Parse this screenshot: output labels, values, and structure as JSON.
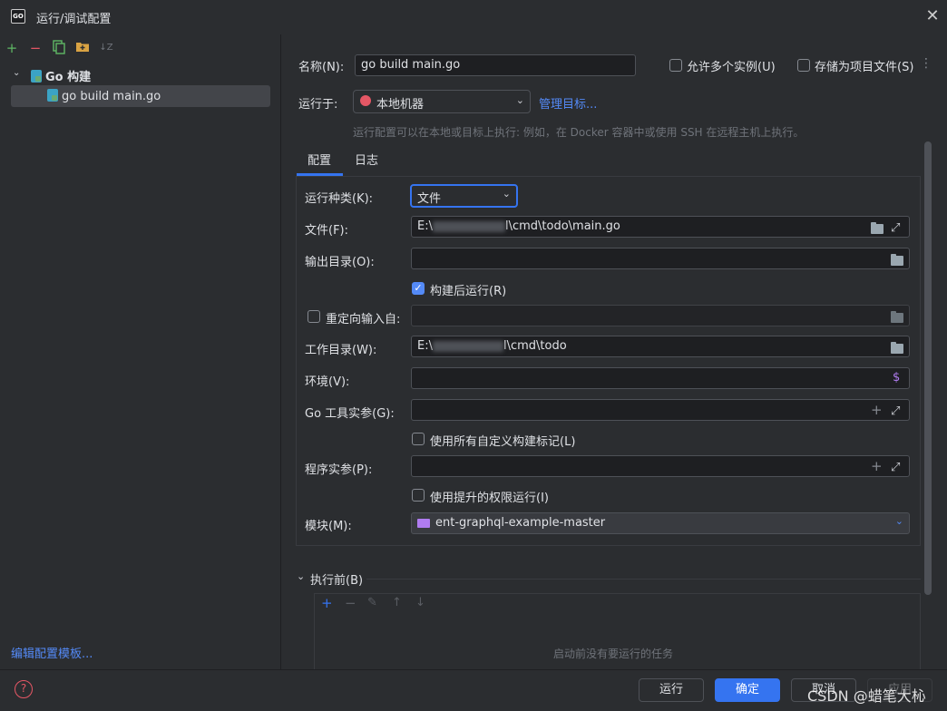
{
  "window": {
    "title": "运行/调试配置",
    "app_icon_text": "GO"
  },
  "left": {
    "toolbar": [
      "add-icon",
      "remove-icon",
      "copy-icon",
      "folder-icon",
      "sort-icon"
    ],
    "group_label": "Go 构建",
    "item_label": "go build main.go",
    "edit_templates": "编辑配置模板..."
  },
  "form": {
    "name_label": "名称(N):",
    "name_value": "go build main.go",
    "allow_multiple": "允许多个实例(U)",
    "store_as_file": "存储为项目文件(S)",
    "run_on_label": "运行于:",
    "run_on_value": "本地机器",
    "manage_targets": "管理目标...",
    "run_on_hint": "运行配置可以在本地或目标上执行: 例如，在 Docker 容器中或使用 SSH 在远程主机上执行。"
  },
  "tabs": [
    "配置",
    "日志"
  ],
  "config": {
    "run_kind_label": "运行种类(K):",
    "run_kind_value": "文件",
    "file_label": "文件(F):",
    "file_prefix": "E:\\",
    "file_suffix": "l\\cmd\\todo\\main.go",
    "output_dir_label": "输出目录(O):",
    "run_after_build": "构建后运行(R)",
    "redirect_input": "重定向输入自:",
    "workdir_label": "工作目录(W):",
    "workdir_prefix": "E:\\",
    "workdir_suffix": "l\\cmd\\todo",
    "env_label": "环境(V):",
    "go_tool_args_label": "Go 工具实参(G):",
    "use_custom_tags": "使用所有自定义构建标记(L)",
    "program_args_label": "程序实参(P):",
    "elevated": "使用提升的权限运行(I)",
    "module_label": "模块(M):",
    "module_value": "ent-graphql-example-master"
  },
  "before": {
    "label": "执行前(B)",
    "empty": "启动前没有要运行的任务"
  },
  "buttons": {
    "run": "运行",
    "ok": "确定",
    "cancel": "取消",
    "apply": "应用"
  },
  "watermark": "CSDN @蜡笔大杺",
  "colors": {
    "accent": "#3574f0",
    "link": "#548af7",
    "bg": "#2b2d30",
    "input_bg": "#1e1f22"
  }
}
